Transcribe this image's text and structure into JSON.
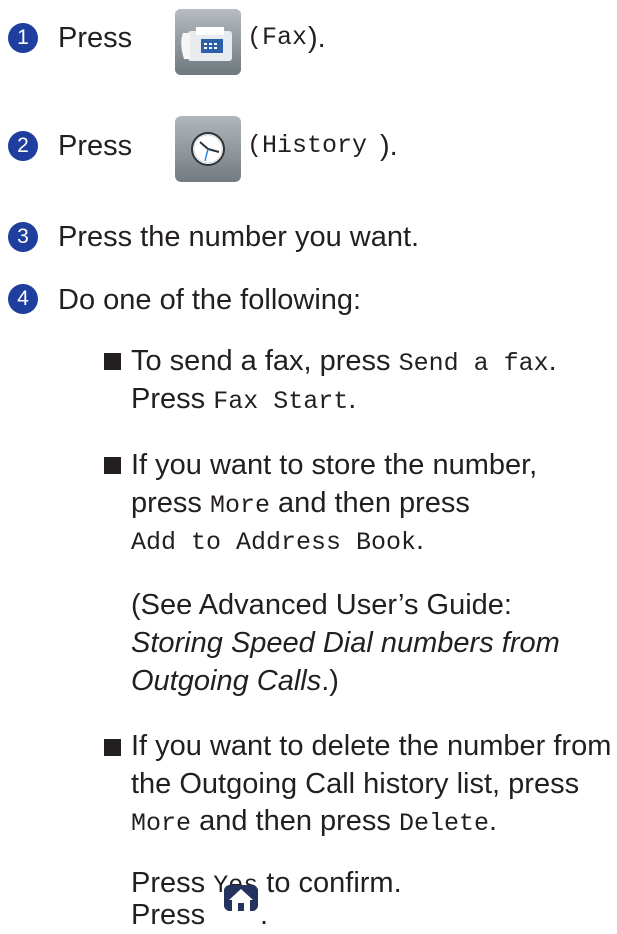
{
  "steps": [
    {
      "number": "1",
      "press": "Press",
      "icon": "fax-icon",
      "paren_open": "(",
      "button": "Fax",
      "paren_close": ")."
    },
    {
      "number": "2",
      "press": "Press",
      "icon": "history-clock-icon",
      "paren_open": "(",
      "button": "History",
      "paren_close": ")."
    },
    {
      "number": "3",
      "text": "Press the number you want."
    },
    {
      "number": "4",
      "text": "Do one of the following:"
    }
  ],
  "options": {
    "send": {
      "line1_text": "To send a fax, press ",
      "line1_btn": "Send a fax",
      "line1_end": ".",
      "line2_text": "Press ",
      "line2_btn": "Fax Start",
      "line2_end": "."
    },
    "store": {
      "line1": "If you want to store the number,",
      "line2_text": "press ",
      "line2_btn": "More",
      "line2_mid": " and then press",
      "line3_btn": "Add to Address Book",
      "line3_end": ".",
      "ref_line1": "(See Advanced User’s Guide:",
      "ref_italic1": "Storing Speed Dial numbers from",
      "ref_italic2": "Outgoing Calls",
      "ref_end": ".)"
    },
    "delete": {
      "line1": "If you want to delete the number from",
      "line2": "the Outgoing Call history list, press",
      "line3_btn": "More",
      "line3_mid": " and then press ",
      "line3_btn2": "Delete",
      "line3_end": ".",
      "confirm_text": "Press ",
      "confirm_btn": "Yes",
      "confirm_end": " to confirm.",
      "home_text": "Press ",
      "home_icon": "home-icon",
      "home_end": "."
    }
  },
  "colors": {
    "step_badge": "#1e3f9e",
    "text": "#231f20"
  }
}
